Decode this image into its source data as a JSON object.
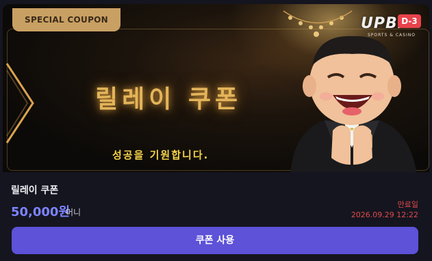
{
  "banner": {
    "tag": "SPECIAL COUPON",
    "title": "릴레이 쿠폰",
    "subtitle": "성공을 기원합니다.",
    "logo_main": "UPBET",
    "logo_sub": "SPORTS & CASINO",
    "day_badge": "D-3"
  },
  "coupon": {
    "name": "릴레이 쿠폰",
    "amount": "50,000원",
    "money_unit": "머니",
    "expire_label": "만료일",
    "expire_date": "2026.09.29 12:22",
    "use_button": "쿠폰 사용"
  },
  "colors": {
    "accent": "#5d52d8",
    "amount": "#7c84ff",
    "expire": "#e04c4c",
    "badge": "#e8434b",
    "gold": "#c9a063"
  }
}
